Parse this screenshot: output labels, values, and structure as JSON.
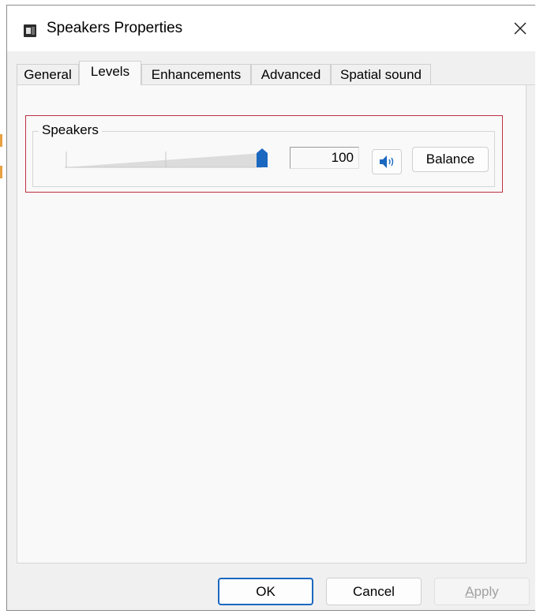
{
  "window": {
    "title": "Speakers Properties",
    "close_label": "✕"
  },
  "tabs": [
    {
      "label": "General",
      "active": false
    },
    {
      "label": "Levels",
      "active": true
    },
    {
      "label": "Enhancements",
      "active": false
    },
    {
      "label": "Advanced",
      "active": false
    },
    {
      "label": "Spatial sound",
      "active": false
    }
  ],
  "levels": {
    "group_label": "Speakers",
    "volume_value": "100",
    "volume_level": 100,
    "balance_label": "Balance",
    "mute_icon": "speaker-icon"
  },
  "footer": {
    "ok_label": "OK",
    "cancel_label": "Cancel",
    "apply_label": "Apply"
  },
  "colors": {
    "accent": "#1a68c0",
    "highlight_border": "#c03040"
  }
}
